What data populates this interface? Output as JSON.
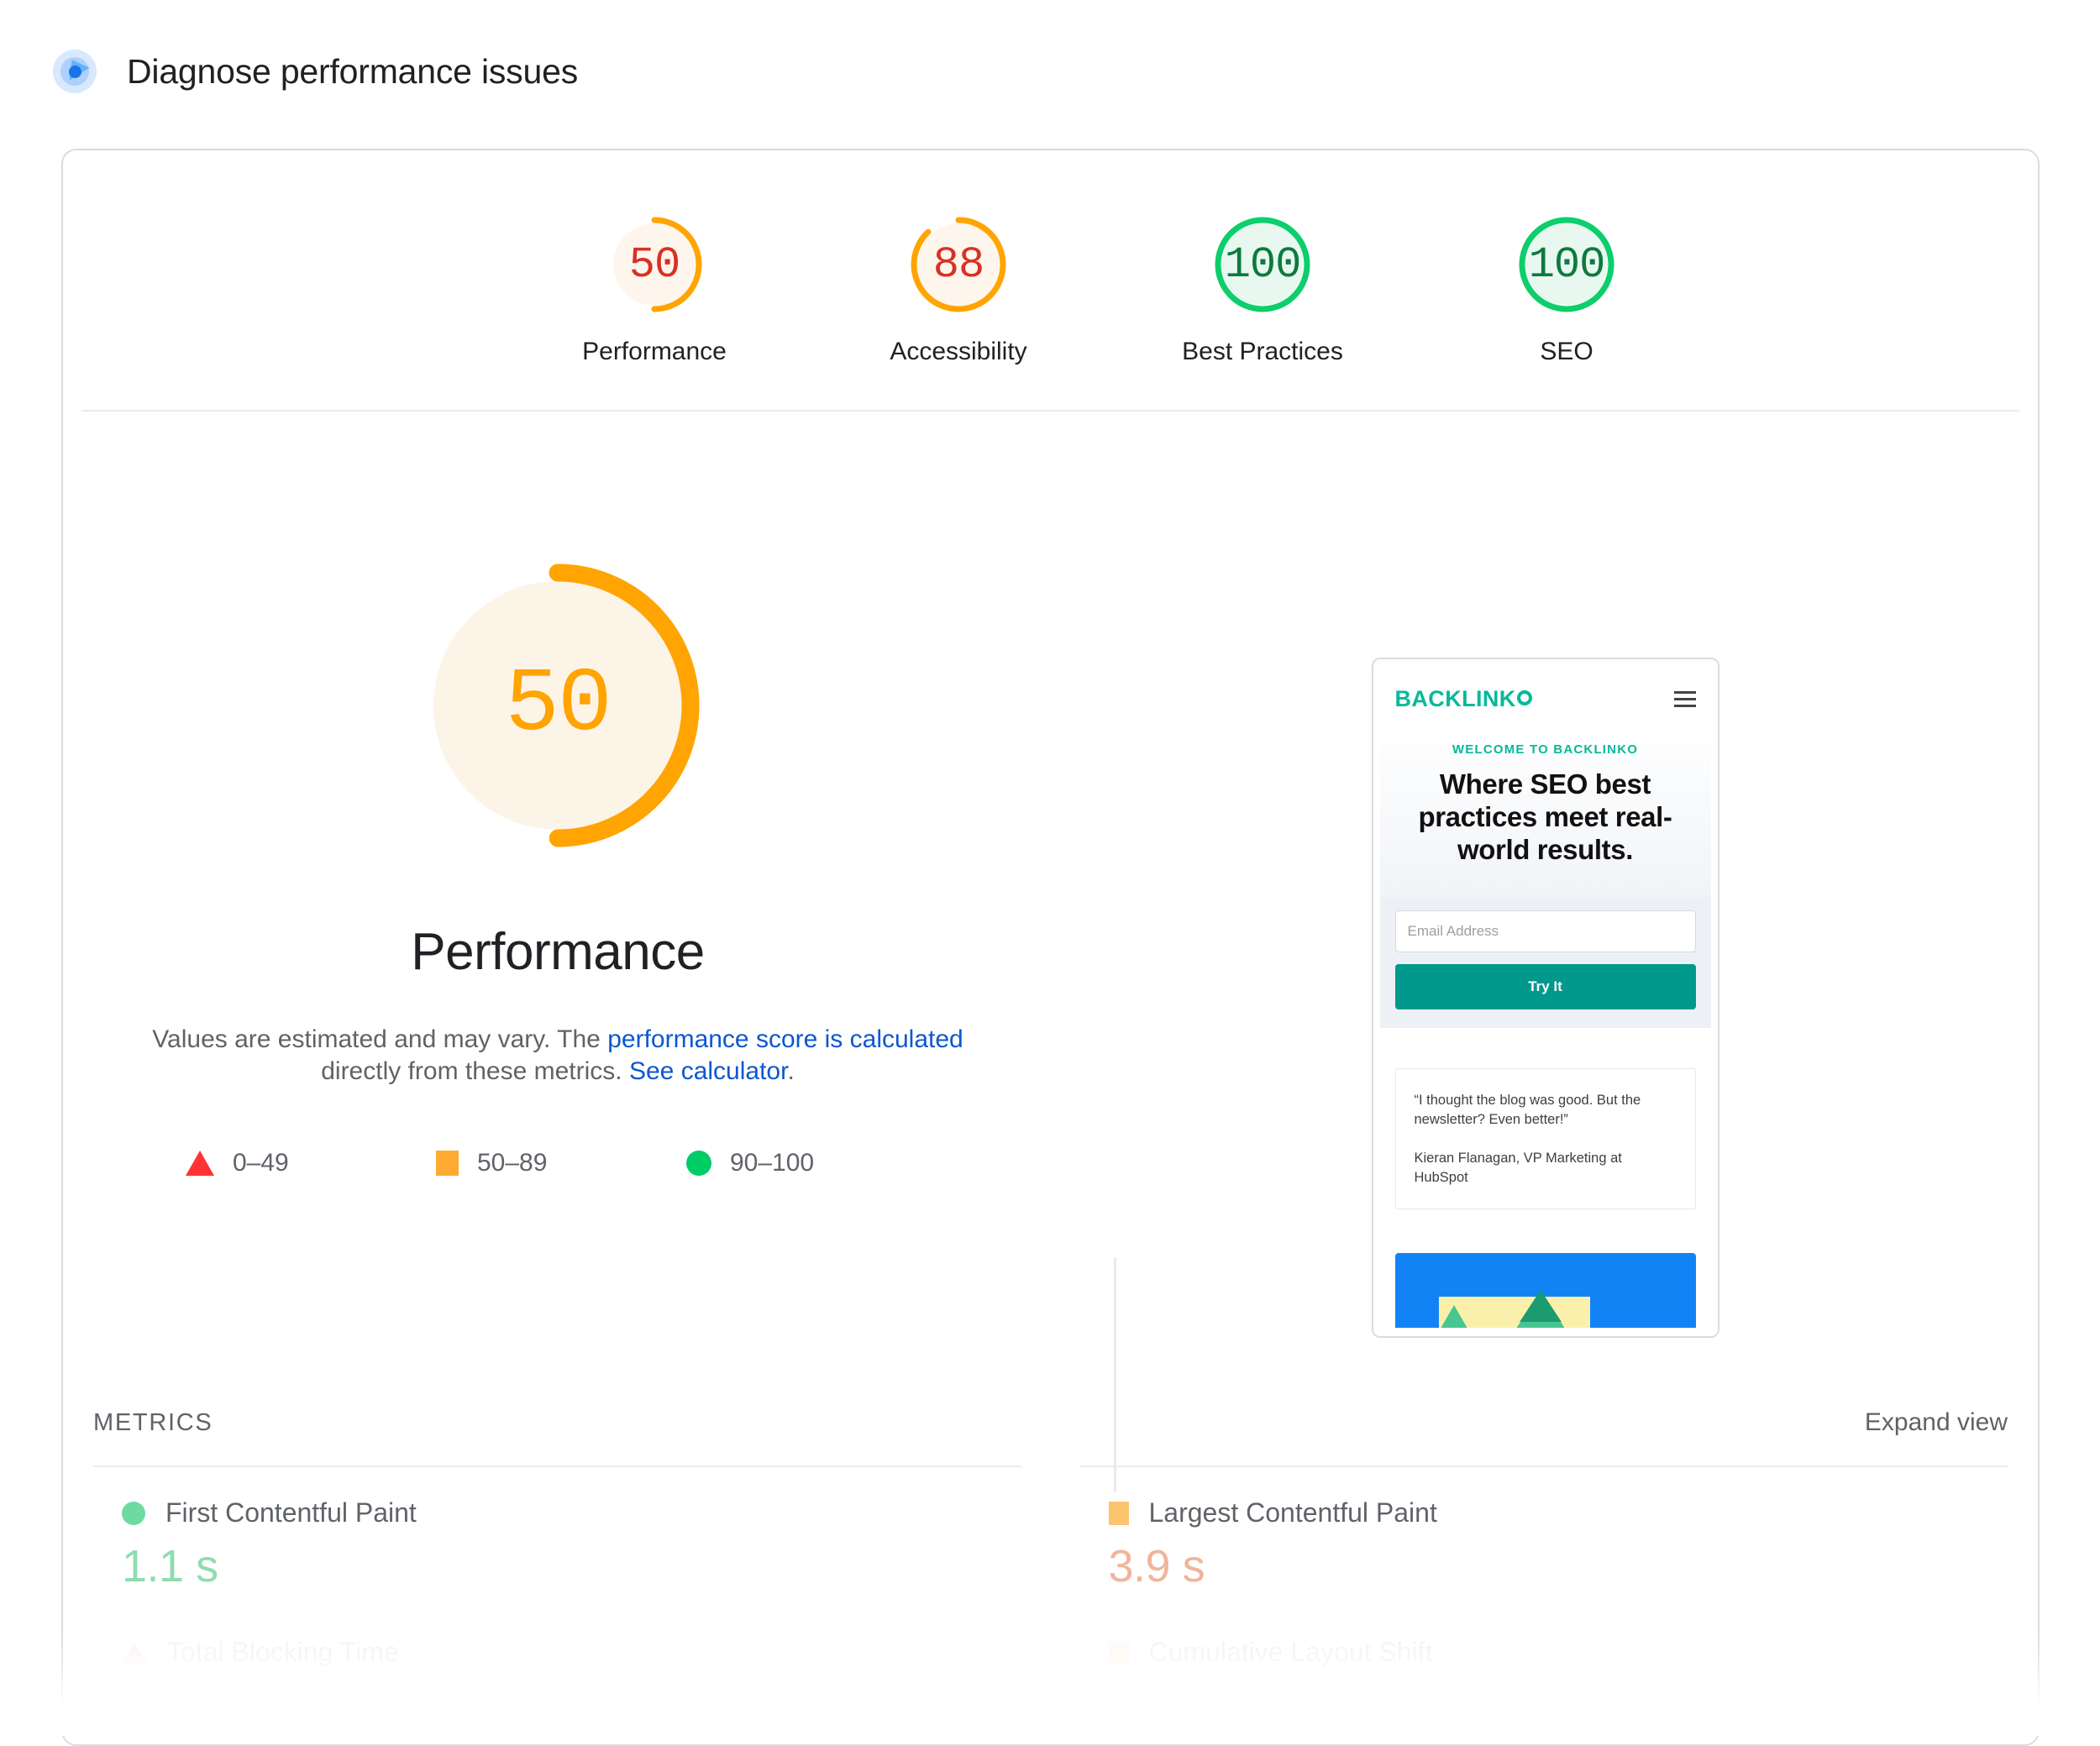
{
  "header": {
    "title": "Diagnose performance issues",
    "logo_icon": "lighthouse-icon"
  },
  "category_scores": [
    {
      "label": "Performance",
      "score": "50",
      "value": 50,
      "color": "#ffa400",
      "track": "#fef6ec",
      "text_color": "#d93025"
    },
    {
      "label": "Accessibility",
      "score": "88",
      "value": 88,
      "color": "#ffa400",
      "track": "#fef6ec",
      "text_color": "#d93025"
    },
    {
      "label": "Best Practices",
      "score": "100",
      "value": 100,
      "color": "#0cce6b",
      "track": "#e8f8f0",
      "text_color": "#0d7a3e"
    },
    {
      "label": "SEO",
      "score": "100",
      "value": 100,
      "color": "#0cce6b",
      "track": "#e8f8f0",
      "text_color": "#0d7a3e"
    }
  ],
  "performance": {
    "gauge_score": "50",
    "gauge_value": 50,
    "gauge_color": "#ffa400",
    "gauge_track": "#fdf4e8",
    "heading": "Performance",
    "desc_part1": "Values are estimated and may vary. The ",
    "desc_link1": "performance score is calculated",
    "desc_part2": " directly from these metrics. ",
    "desc_link2": "See calculator",
    "desc_part3": ".",
    "link_color": "#0b57d0"
  },
  "legend": [
    {
      "icon": "triangle-fail-icon",
      "range": "0–49",
      "color": "#ff3333"
    },
    {
      "icon": "square-average-icon",
      "range": "50–89",
      "color": "#ffaa33"
    },
    {
      "icon": "circle-pass-icon",
      "range": "90–100",
      "color": "#00cc66"
    }
  ],
  "screenshot_preview": {
    "device_frame": "mobile-device-frame",
    "site_logo": "BACKLINK",
    "menu_icon": "hamburger-menu-icon",
    "eyebrow": "WELCOME TO BACKLINKO",
    "headline": "Where SEO best practices meet real-world results.",
    "email_placeholder": "Email Address",
    "cta_label": "Try It",
    "quote": "“I thought the blog was good. But the newsletter? Even better!”",
    "quote_attribution": "Kieran Flanagan, VP Marketing at HubSpot",
    "brand_color": "#06b99a",
    "cta_color": "#00998c"
  },
  "metrics_section": {
    "title": "METRICS",
    "expand_label": "Expand view",
    "items": [
      {
        "name": "First Contentful Paint",
        "value": "1.1 s",
        "status": "pass",
        "icon": "circle-pass-icon",
        "faded": false
      },
      {
        "name": "Largest Contentful Paint",
        "value": "3.9 s",
        "status": "average",
        "icon": "square-average-icon",
        "faded": false
      },
      {
        "name": "Total Blocking Time",
        "value": "",
        "status": "fail",
        "icon": "triangle-fail-icon",
        "faded": true
      },
      {
        "name": "Cumulative Layout Shift",
        "value": "",
        "status": "average",
        "icon": "square-average-icon",
        "faded": true
      }
    ]
  }
}
